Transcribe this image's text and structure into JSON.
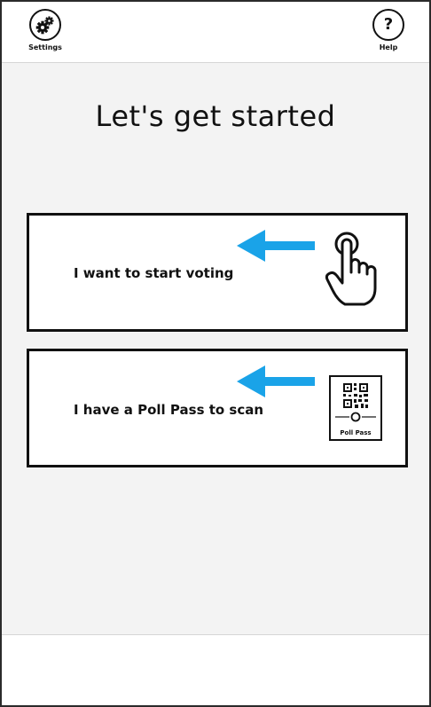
{
  "header": {
    "settings_label": "Settings",
    "help_label": "Help",
    "help_glyph": "?"
  },
  "main": {
    "title": "Let's get started",
    "options": [
      {
        "label": "I want to start voting",
        "icon": "hand-tap-icon"
      },
      {
        "label": "I have a Poll Pass to scan",
        "icon": "poll-pass-qr-icon",
        "icon_caption": "Poll Pass"
      }
    ]
  },
  "colors": {
    "arrow": "#1aa3e8",
    "border": "#111111",
    "background": "#f3f3f3"
  }
}
